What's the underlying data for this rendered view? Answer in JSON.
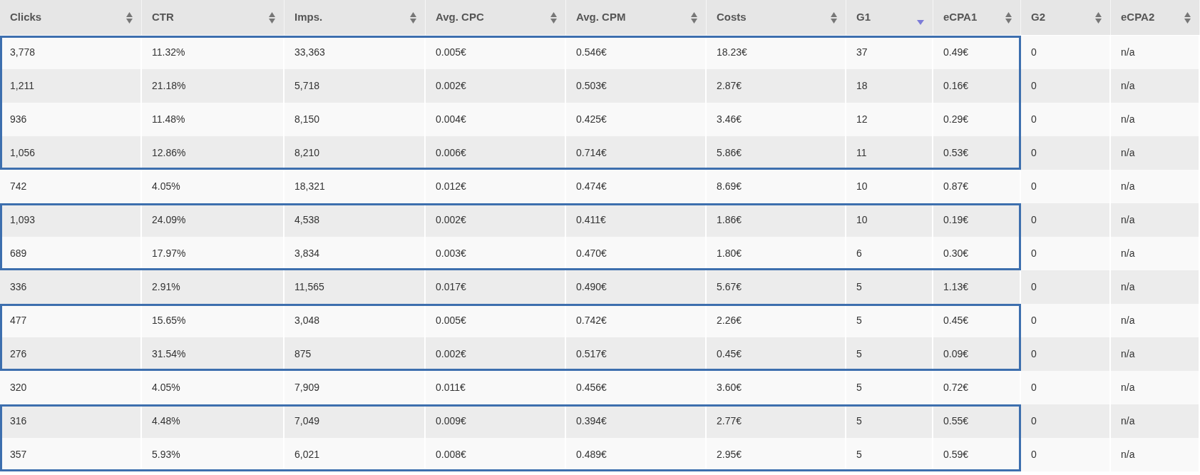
{
  "table": {
    "columns": [
      {
        "label": "Clicks",
        "sorted": false
      },
      {
        "label": "CTR",
        "sorted": false
      },
      {
        "label": "Imps.",
        "sorted": false
      },
      {
        "label": "Avg. CPC",
        "sorted": false
      },
      {
        "label": "Avg. CPM",
        "sorted": false
      },
      {
        "label": "Costs",
        "sorted": false
      },
      {
        "label": "G1",
        "sorted": true
      },
      {
        "label": "eCPA1",
        "sorted": false
      },
      {
        "label": "G2",
        "sorted": false
      },
      {
        "label": "eCPA2",
        "sorted": false
      }
    ],
    "row_groups": [
      {
        "highlighted": true,
        "rows": [
          [
            "3,778",
            "11.32%",
            "33,363",
            "0.005€",
            "0.546€",
            "18.23€",
            "37",
            "0.49€",
            "0",
            "n/a"
          ],
          [
            "1,211",
            "21.18%",
            "5,718",
            "0.002€",
            "0.503€",
            "2.87€",
            "18",
            "0.16€",
            "0",
            "n/a"
          ],
          [
            "936",
            "11.48%",
            "8,150",
            "0.004€",
            "0.425€",
            "3.46€",
            "12",
            "0.29€",
            "0",
            "n/a"
          ],
          [
            "1,056",
            "12.86%",
            "8,210",
            "0.006€",
            "0.714€",
            "5.86€",
            "11",
            "0.53€",
            "0",
            "n/a"
          ]
        ]
      },
      {
        "highlighted": false,
        "rows": [
          [
            "742",
            "4.05%",
            "18,321",
            "0.012€",
            "0.474€",
            "8.69€",
            "10",
            "0.87€",
            "0",
            "n/a"
          ]
        ]
      },
      {
        "highlighted": true,
        "rows": [
          [
            "1,093",
            "24.09%",
            "4,538",
            "0.002€",
            "0.411€",
            "1.86€",
            "10",
            "0.19€",
            "0",
            "n/a"
          ],
          [
            "689",
            "17.97%",
            "3,834",
            "0.003€",
            "0.470€",
            "1.80€",
            "6",
            "0.30€",
            "0",
            "n/a"
          ]
        ]
      },
      {
        "highlighted": false,
        "rows": [
          [
            "336",
            "2.91%",
            "11,565",
            "0.017€",
            "0.490€",
            "5.67€",
            "5",
            "1.13€",
            "0",
            "n/a"
          ]
        ]
      },
      {
        "highlighted": true,
        "rows": [
          [
            "477",
            "15.65%",
            "3,048",
            "0.005€",
            "0.742€",
            "2.26€",
            "5",
            "0.45€",
            "0",
            "n/a"
          ],
          [
            "276",
            "31.54%",
            "875",
            "0.002€",
            "0.517€",
            "0.45€",
            "5",
            "0.09€",
            "0",
            "n/a"
          ]
        ]
      },
      {
        "highlighted": false,
        "rows": [
          [
            "320",
            "4.05%",
            "7,909",
            "0.011€",
            "0.456€",
            "3.60€",
            "5",
            "0.72€",
            "0",
            "n/a"
          ]
        ]
      },
      {
        "highlighted": true,
        "rows": [
          [
            "316",
            "4.48%",
            "7,049",
            "0.009€",
            "0.394€",
            "2.77€",
            "5",
            "0.55€",
            "0",
            "n/a"
          ],
          [
            "357",
            "5.93%",
            "6,021",
            "0.008€",
            "0.489€",
            "2.95€",
            "5",
            "0.59€",
            "0",
            "n/a"
          ]
        ]
      }
    ]
  }
}
